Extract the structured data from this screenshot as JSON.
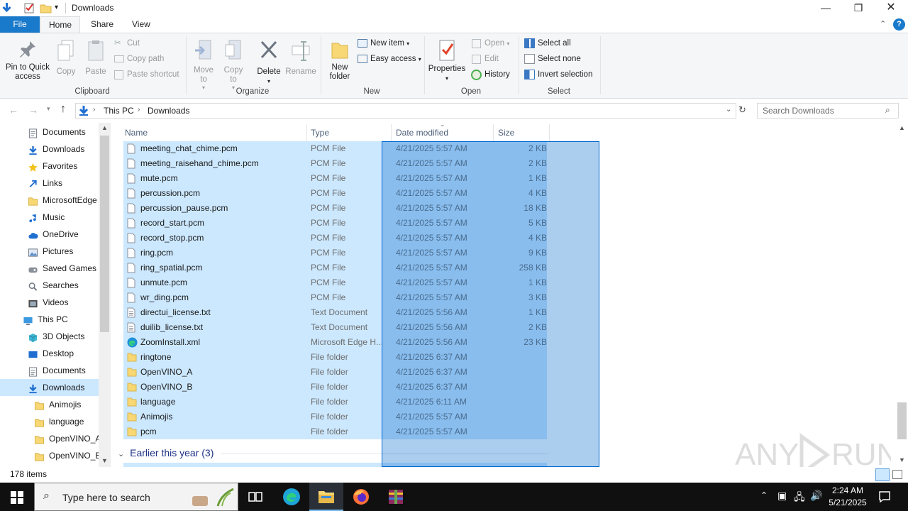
{
  "window": {
    "title": "Downloads"
  },
  "tabs": [
    {
      "label": "File"
    },
    {
      "label": "Home"
    },
    {
      "label": "Share"
    },
    {
      "label": "View"
    }
  ],
  "ribbon": {
    "clipboard": {
      "label": "Clipboard",
      "pin": "Pin to Quick\naccess",
      "copy": "Copy",
      "paste": "Paste",
      "cut": "Cut",
      "copy_path": "Copy path",
      "paste_shortcut": "Paste shortcut"
    },
    "organize": {
      "label": "Organize",
      "move_to": "Move\nto",
      "copy_to": "Copy\nto",
      "delete": "Delete",
      "rename": "Rename"
    },
    "new": {
      "label": "New",
      "new_folder": "New\nfolder",
      "new_item": "New item",
      "easy_access": "Easy access"
    },
    "open": {
      "label": "Open",
      "properties": "Properties",
      "open": "Open",
      "edit": "Edit",
      "history": "History"
    },
    "select": {
      "label": "Select",
      "select_all": "Select all",
      "select_none": "Select none",
      "invert": "Invert selection"
    }
  },
  "address": {
    "crumbs": [
      "This PC",
      "Downloads"
    ],
    "search_placeholder": "Search Downloads"
  },
  "nav": [
    {
      "label": "Documents",
      "icon": "documents-icon",
      "indent": 1
    },
    {
      "label": "Downloads",
      "icon": "downloads-icon",
      "indent": 1
    },
    {
      "label": "Favorites",
      "icon": "star-icon",
      "indent": 1
    },
    {
      "label": "Links",
      "icon": "links-icon",
      "indent": 1
    },
    {
      "label": "MicrosoftEdge",
      "icon": "folder-icon",
      "indent": 1
    },
    {
      "label": "Music",
      "icon": "music-icon",
      "indent": 1
    },
    {
      "label": "OneDrive",
      "icon": "cloud-icon",
      "indent": 1
    },
    {
      "label": "Pictures",
      "icon": "pictures-icon",
      "indent": 1
    },
    {
      "label": "Saved Games",
      "icon": "games-icon",
      "indent": 1
    },
    {
      "label": "Searches",
      "icon": "search-icon",
      "indent": 1
    },
    {
      "label": "Videos",
      "icon": "videos-icon",
      "indent": 1
    },
    {
      "label": "This PC",
      "icon": "pc-icon",
      "indent": 0
    },
    {
      "label": "3D Objects",
      "icon": "3d-icon",
      "indent": 1
    },
    {
      "label": "Desktop",
      "icon": "desktop-icon",
      "indent": 1
    },
    {
      "label": "Documents",
      "icon": "documents-icon",
      "indent": 1
    },
    {
      "label": "Downloads",
      "icon": "downloads-icon",
      "indent": 1,
      "selected": true
    },
    {
      "label": "Animojis",
      "icon": "folder-icon",
      "indent": 2
    },
    {
      "label": "language",
      "icon": "folder-icon",
      "indent": 2
    },
    {
      "label": "OpenVINO_A",
      "icon": "folder-icon",
      "indent": 2
    },
    {
      "label": "OpenVINO_B",
      "icon": "folder-icon",
      "indent": 2
    }
  ],
  "columns": {
    "name": "Name",
    "type": "Type",
    "date": "Date modified",
    "size": "Size"
  },
  "files": [
    {
      "name": "meeting_chat_chime.pcm",
      "type": "PCM File",
      "date": "4/21/2025 5:57 AM",
      "size": "2 KB",
      "kind": "file"
    },
    {
      "name": "meeting_raisehand_chime.pcm",
      "type": "PCM File",
      "date": "4/21/2025 5:57 AM",
      "size": "2 KB",
      "kind": "file"
    },
    {
      "name": "mute.pcm",
      "type": "PCM File",
      "date": "4/21/2025 5:57 AM",
      "size": "1 KB",
      "kind": "file"
    },
    {
      "name": "percussion.pcm",
      "type": "PCM File",
      "date": "4/21/2025 5:57 AM",
      "size": "4 KB",
      "kind": "file"
    },
    {
      "name": "percussion_pause.pcm",
      "type": "PCM File",
      "date": "4/21/2025 5:57 AM",
      "size": "18 KB",
      "kind": "file"
    },
    {
      "name": "record_start.pcm",
      "type": "PCM File",
      "date": "4/21/2025 5:57 AM",
      "size": "5 KB",
      "kind": "file"
    },
    {
      "name": "record_stop.pcm",
      "type": "PCM File",
      "date": "4/21/2025 5:57 AM",
      "size": "4 KB",
      "kind": "file"
    },
    {
      "name": "ring.pcm",
      "type": "PCM File",
      "date": "4/21/2025 5:57 AM",
      "size": "9 KB",
      "kind": "file"
    },
    {
      "name": "ring_spatial.pcm",
      "type": "PCM File",
      "date": "4/21/2025 5:57 AM",
      "size": "258 KB",
      "kind": "file"
    },
    {
      "name": "unmute.pcm",
      "type": "PCM File",
      "date": "4/21/2025 5:57 AM",
      "size": "1 KB",
      "kind": "file"
    },
    {
      "name": "wr_ding.pcm",
      "type": "PCM File",
      "date": "4/21/2025 5:57 AM",
      "size": "3 KB",
      "kind": "file"
    },
    {
      "name": "directui_license.txt",
      "type": "Text Document",
      "date": "4/21/2025 5:56 AM",
      "size": "1 KB",
      "kind": "text"
    },
    {
      "name": "duilib_license.txt",
      "type": "Text Document",
      "date": "4/21/2025 5:56 AM",
      "size": "2 KB",
      "kind": "text"
    },
    {
      "name": "ZoomInstall.xml",
      "type": "Microsoft Edge H...",
      "date": "4/21/2025 5:56 AM",
      "size": "23 KB",
      "kind": "edge"
    },
    {
      "name": "ringtone",
      "type": "File folder",
      "date": "4/21/2025 6:37 AM",
      "size": "",
      "kind": "folder"
    },
    {
      "name": "OpenVINO_A",
      "type": "File folder",
      "date": "4/21/2025 6:37 AM",
      "size": "",
      "kind": "folder"
    },
    {
      "name": "OpenVINO_B",
      "type": "File folder",
      "date": "4/21/2025 6:37 AM",
      "size": "",
      "kind": "folder"
    },
    {
      "name": "language",
      "type": "File folder",
      "date": "4/21/2025 6:11 AM",
      "size": "",
      "kind": "folder"
    },
    {
      "name": "Animojis",
      "type": "File folder",
      "date": "4/21/2025 5:57 AM",
      "size": "",
      "kind": "folder"
    },
    {
      "name": "pcm",
      "type": "File folder",
      "date": "4/21/2025 5:57 AM",
      "size": "",
      "kind": "folder"
    }
  ],
  "group_header": "Earlier this year (3)",
  "status": {
    "items": "178 items"
  },
  "watermark": "ANY RUN",
  "taskbar": {
    "search_placeholder": "Type here to search",
    "time": "2:24 AM",
    "date": "5/21/2025"
  },
  "colors": {
    "accent": "#1979ca",
    "selection": "#cce8ff",
    "rubber_band": "#0066cc",
    "folder": "#f8d775"
  }
}
